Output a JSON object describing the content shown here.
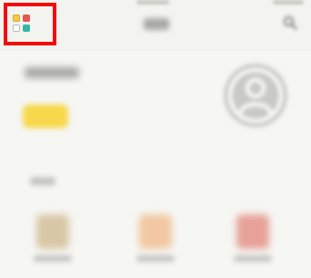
{
  "header": {
    "apps_icon": "apps-grid-icon",
    "title": "",
    "search_icon": "search-icon"
  },
  "profile": {
    "prompt": "",
    "login_label": "",
    "avatar_icon": "person-icon"
  },
  "section": {
    "label": "",
    "items": [
      {
        "icon": "item-icon",
        "label": ""
      },
      {
        "icon": "item-icon",
        "label": ""
      },
      {
        "icon": "item-icon",
        "label": ""
      }
    ]
  },
  "colors": {
    "highlight_border": "#f20d0d",
    "accent_yellow": "#f7d84a",
    "background": "#f6f6f3"
  }
}
